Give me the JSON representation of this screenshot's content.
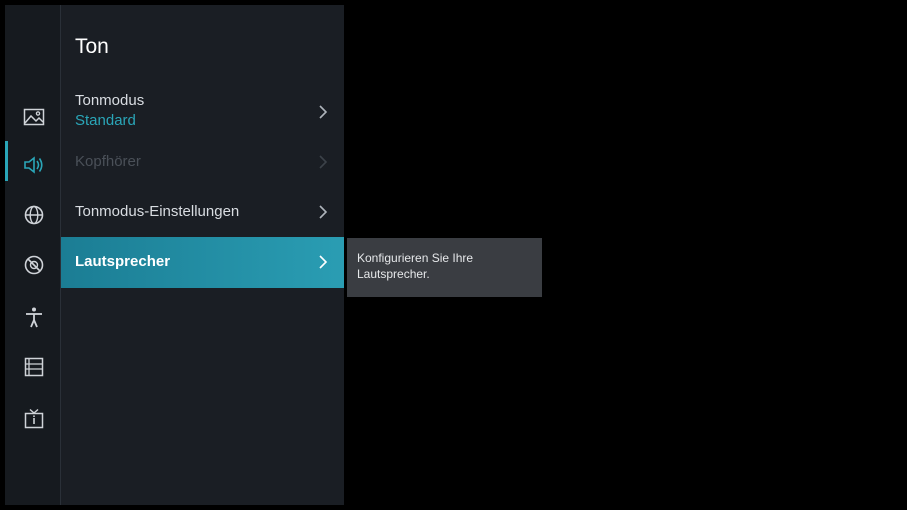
{
  "panel": {
    "title": "Ton",
    "items": [
      {
        "label": "Tonmodus",
        "value": "Standard",
        "state": "normal"
      },
      {
        "label": "Kopfhörer",
        "state": "disabled"
      },
      {
        "label": "Tonmodus-Einstellungen",
        "state": "normal"
      },
      {
        "label": "Lautsprecher",
        "state": "selected"
      }
    ]
  },
  "tooltip": {
    "text": "Konfigurieren Sie Ihre Lautsprecher."
  },
  "sidebar": {
    "icons": [
      "picture-icon",
      "sound-icon",
      "network-icon",
      "general-icon",
      "accessibility-icon",
      "apps-list-icon",
      "tv-info-icon"
    ],
    "active": "sound-icon"
  },
  "colors": {
    "accent": "#2aa6b8",
    "selected_bg": "#1f8ca3",
    "panel_bg": "#1a1e24",
    "rail_bg": "#161a1f",
    "tooltip_bg": "#3a3d42"
  }
}
